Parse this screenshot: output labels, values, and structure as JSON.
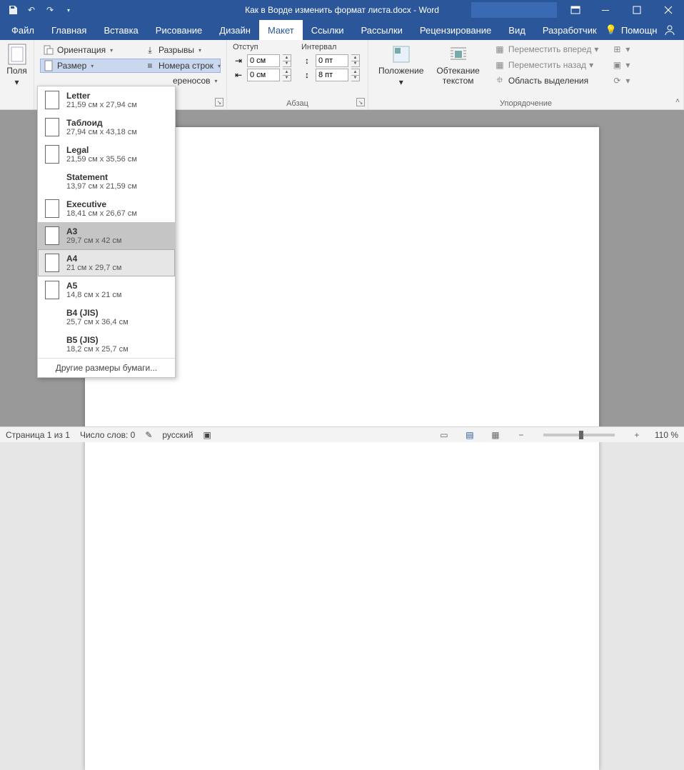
{
  "title": "Как в Ворде изменить формат листа.docx  -  Word",
  "tabs": {
    "file": "Файл",
    "home": "Главная",
    "insert": "Вставка",
    "draw": "Рисование",
    "design": "Дизайн",
    "layout": "Макет",
    "references": "Ссылки",
    "mailings": "Рассылки",
    "review": "Рецензирование",
    "view": "Вид",
    "developer": "Разработчик"
  },
  "help_label": "Помощн",
  "ribbon": {
    "margins": "Поля",
    "orientation": "Ориентация",
    "size": "Размер",
    "breaks": "Разрывы",
    "line_numbers": "Номера строк",
    "hyphenation_fragment": "ереносов",
    "indent_header": "Отступ",
    "spacing_header": "Интервал",
    "indent_left": "0 см",
    "indent_right": "0 см",
    "spacing_before": "0 пт",
    "spacing_after": "8 пт",
    "paragraph_group": "Абзац",
    "position": "Положение",
    "wrap": "Обтекание",
    "wrap2": "текстом",
    "bring_forward": "Переместить вперед",
    "send_backward": "Переместить назад",
    "selection_pane": "Область выделения",
    "arrange_group": "Упорядочение"
  },
  "sizes": [
    {
      "name": "Letter",
      "dim": "21,59 см x 27,94 см",
      "icon": true
    },
    {
      "name": "Таблоид",
      "dim": "27,94 см x 43,18 см",
      "icon": true
    },
    {
      "name": "Legal",
      "dim": "21,59 см x 35,56 см",
      "icon": true
    },
    {
      "name": "Statement",
      "dim": "13,97 см x 21,59 см",
      "icon": false
    },
    {
      "name": "Executive",
      "dim": "18,41 см x 26,67 см",
      "icon": true
    },
    {
      "name": "A3",
      "dim": "29,7 см x 42 см",
      "icon": true,
      "hover": true
    },
    {
      "name": "A4",
      "dim": "21 см x 29,7 см",
      "icon": true,
      "selected": true
    },
    {
      "name": "A5",
      "dim": "14,8 см x 21 см",
      "icon": true
    },
    {
      "name": "B4 (JIS)",
      "dim": "25,7 см x 36,4 см",
      "icon": false
    },
    {
      "name": "B5 (JIS)",
      "dim": "18,2 см x 25,7 см",
      "icon": false
    }
  ],
  "more_sizes": "Другие размеры бумаги...",
  "status": {
    "page": "Страница 1 из 1",
    "words": "Число слов: 0",
    "lang": "русский",
    "zoom": "110 %"
  }
}
